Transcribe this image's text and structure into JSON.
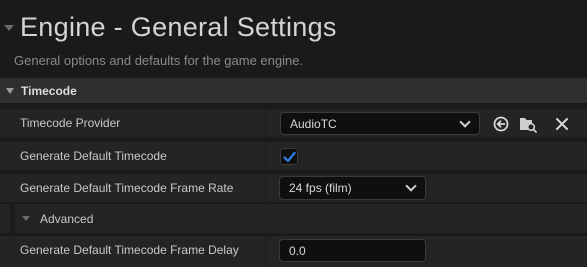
{
  "header": {
    "title": "Engine - General Settings",
    "subtitle": "General options and defaults for the game engine."
  },
  "section": {
    "title": "Timecode"
  },
  "rows": {
    "timecode_provider": {
      "label": "Timecode Provider",
      "value": "AudioTC",
      "icons": [
        "reset-arrow-icon",
        "browse-folder-icon",
        "clear-x-icon"
      ]
    },
    "generate_default_timecode": {
      "label": "Generate Default Timecode",
      "checked": true
    },
    "frame_rate": {
      "label": "Generate Default Timecode Frame Rate",
      "value": "24 fps (film)"
    },
    "advanced": {
      "label": "Advanced"
    },
    "frame_delay": {
      "label": "Generate Default Timecode Frame Delay",
      "value": "0.0"
    }
  },
  "colors": {
    "background": "#1a1a1a",
    "row": "#242424",
    "section": "#2f2f2f",
    "checkbox_accent": "#2f7de1"
  }
}
